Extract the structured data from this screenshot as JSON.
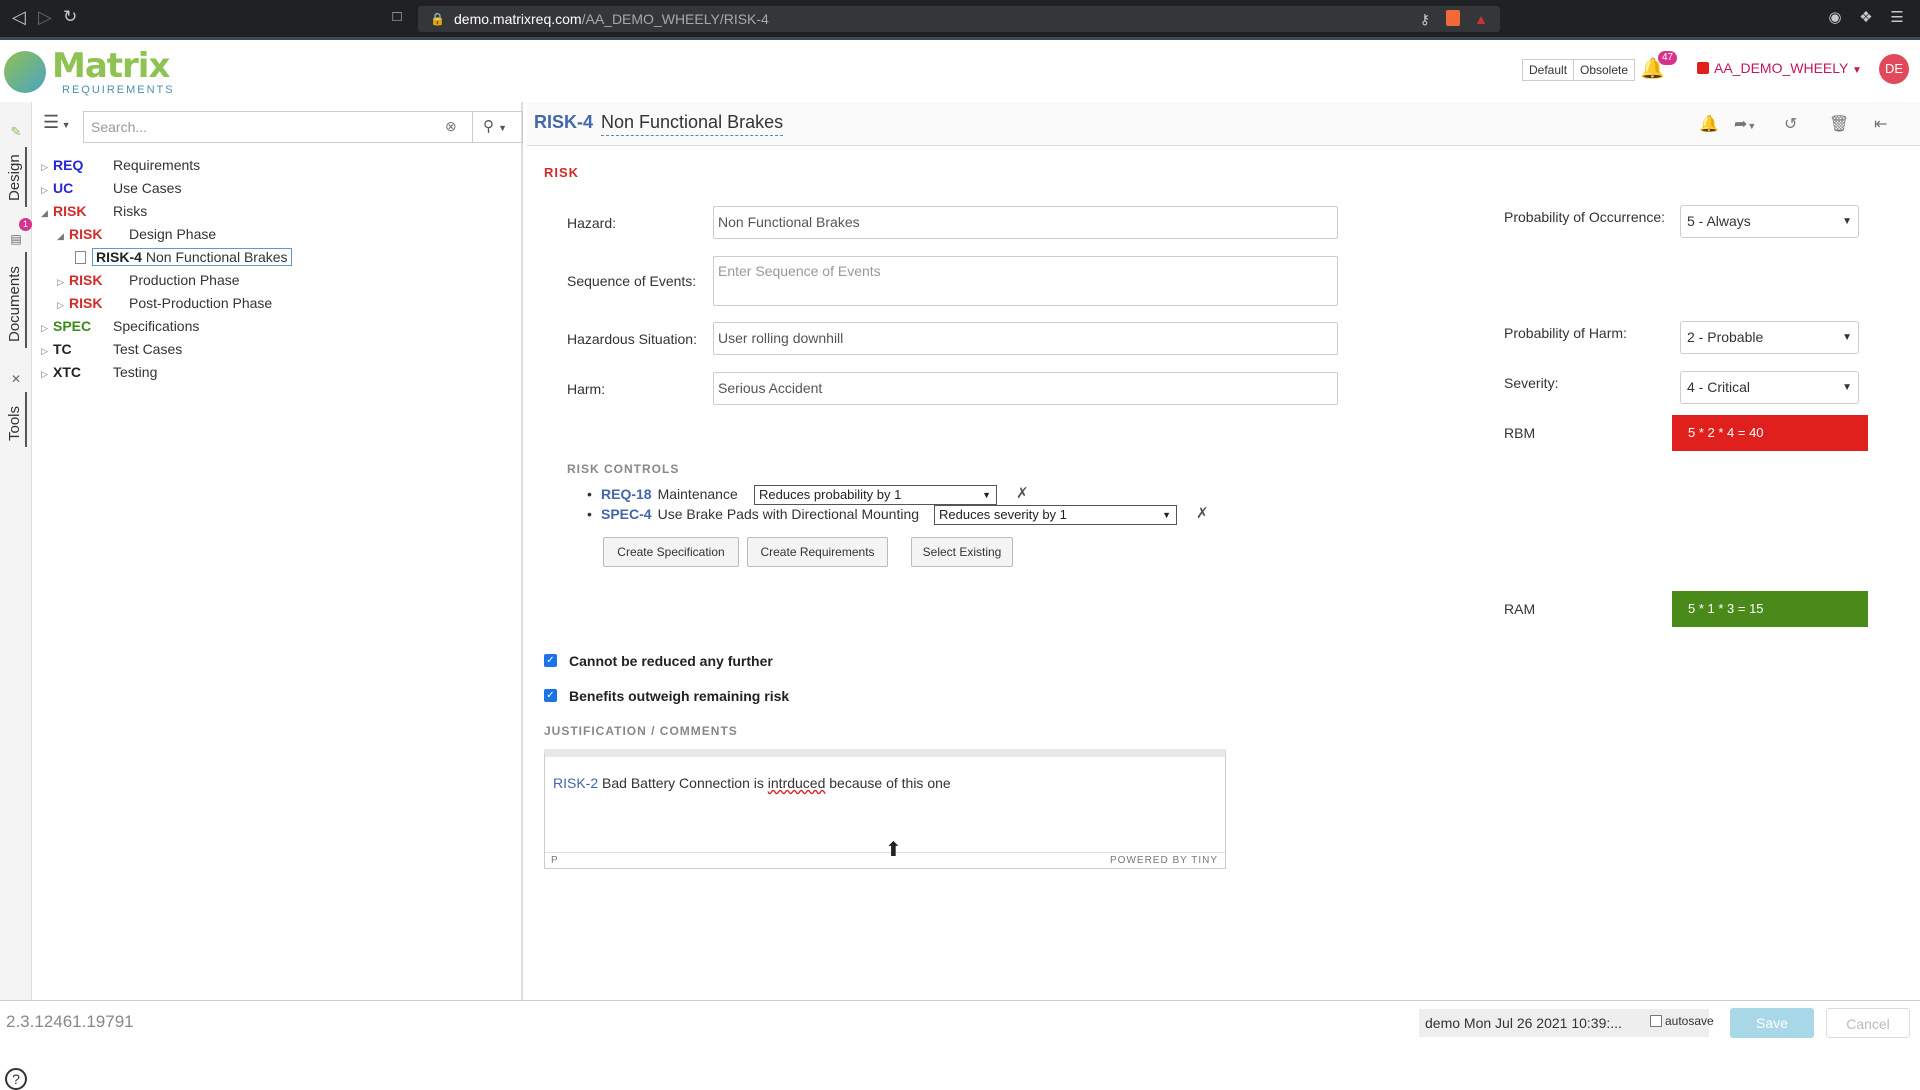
{
  "browser": {
    "url_host": "demo.matrixreq.com",
    "url_path": "/AA_DEMO_WHEELY/RISK-4"
  },
  "header": {
    "logo_text": "Matrix",
    "logo_sub": "REQUIREMENTS",
    "default_label": "Default",
    "obsolete_label": "Obsolete",
    "notification_count": "47",
    "project": "AA_DEMO_WHEELY",
    "avatar": "DE"
  },
  "sidebar_tabs": {
    "design": "Design",
    "documents": "Documents",
    "documents_badge": "1",
    "tools": "Tools"
  },
  "search": {
    "placeholder": "Search..."
  },
  "tree": [
    {
      "key": "REQ",
      "label": "Requirements",
      "cat": "req"
    },
    {
      "key": "UC",
      "label": "Use Cases",
      "cat": "uc"
    },
    {
      "key": "RISK",
      "label": "Risks",
      "cat": "risk"
    },
    {
      "key": "RISK",
      "label": "Design Phase",
      "cat": "risk"
    },
    {
      "key": "RISK-4",
      "label": "Non Functional Brakes",
      "cat": "item"
    },
    {
      "key": "RISK",
      "label": "Production Phase",
      "cat": "risk"
    },
    {
      "key": "RISK",
      "label": "Post-Production Phase",
      "cat": "risk"
    },
    {
      "key": "SPEC",
      "label": "Specifications",
      "cat": "spec"
    },
    {
      "key": "TC",
      "label": "Test Cases",
      "cat": "tc"
    },
    {
      "key": "XTC",
      "label": "Testing",
      "cat": "xtc"
    }
  ],
  "item": {
    "id": "RISK-4",
    "title": "Non Functional Brakes",
    "section": "RISK",
    "hazard_label": "Hazard:",
    "hazard": "Non Functional Brakes",
    "sequence_label": "Sequence of Events:",
    "sequence_placeholder": "Enter Sequence of Events",
    "situation_label": "Hazardous Situation:",
    "situation": "User rolling downhill",
    "harm_label": "Harm:",
    "harm": "Serious Accident",
    "occurrence_label": "Probability of Occurrence:",
    "occurrence": "5 - Always",
    "prob_harm_label": "Probability of Harm:",
    "prob_harm": "2 - Probable",
    "severity_label": "Severity:",
    "severity": "4 - Critical",
    "rbm_label": "RBM",
    "rbm": "5 * 2 * 4 = 40",
    "ram_label": "RAM",
    "ram": "5 * 1 * 3 = 15"
  },
  "risk_controls": {
    "title": "RISK CONTROLS",
    "items": [
      {
        "key": "REQ-18",
        "name": "Maintenance",
        "effect": "Reduces probability by 1"
      },
      {
        "key": "SPEC-4",
        "name": "Use Brake Pads with Directional Mounting",
        "effect": "Reduces severity by 1"
      }
    ],
    "btn_spec": "Create Specification",
    "btn_req": "Create Requirements",
    "btn_existing": "Select Existing"
  },
  "checks": {
    "cannot_reduce": "Cannot be reduced any further",
    "benefits": "Benefits outweigh remaining risk"
  },
  "justification": {
    "title": "JUSTIFICATION / COMMENTS",
    "link": "RISK-2",
    "text_pre": "Bad Battery Connection is ",
    "misspelled": "intrduced",
    "text_post": " because of this one",
    "path": "P",
    "powered": "POWERED BY TINY"
  },
  "status": {
    "version": "2.3.12461.19791",
    "info": "demo Mon Jul 26 2021 10:39:...",
    "autosave": "autosave",
    "save": "Save",
    "cancel": "Cancel"
  },
  "colors": {
    "rbm": "#e0201c",
    "ram": "#4a8a1a"
  }
}
